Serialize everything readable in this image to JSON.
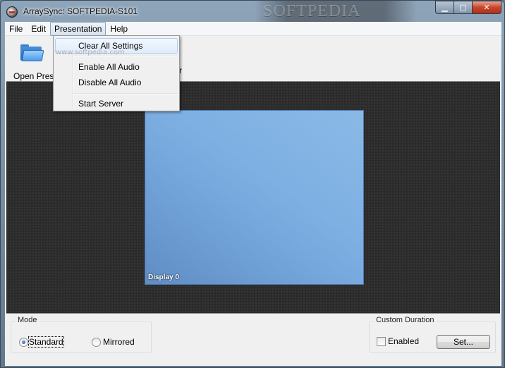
{
  "window": {
    "title": "ArraySync: SOFTPEDIA-S101",
    "watermark": "SOFTPEDIA",
    "controls": {
      "minimize": "▁",
      "maximize": "▢",
      "close": "✕"
    }
  },
  "menubar": {
    "items": [
      "File",
      "Edit",
      "Presentation",
      "Help"
    ],
    "open_item": "Presentation"
  },
  "presentation_menu": {
    "items": [
      "Clear All Settings",
      "Enable All Audio",
      "Disable All Audio",
      "Start Server"
    ],
    "hovered": "Clear All Settings"
  },
  "toolbar": {
    "open_label": "Open Prese",
    "trailing_label_fragment": "r",
    "small_watermark": "www.softpedia.com"
  },
  "display": {
    "tile_label": "Display 0"
  },
  "mode": {
    "legend": "Mode",
    "options": [
      "Standard",
      "Mirrored"
    ],
    "selected": "Standard"
  },
  "custom_duration": {
    "legend": "Custom Duration",
    "enabled_label": "Enabled",
    "enabled": false,
    "set_button": "Set..."
  },
  "colors": {
    "display_background": "#2b2b2b",
    "tile": "#77a9de",
    "close_button": "#c7452d"
  }
}
